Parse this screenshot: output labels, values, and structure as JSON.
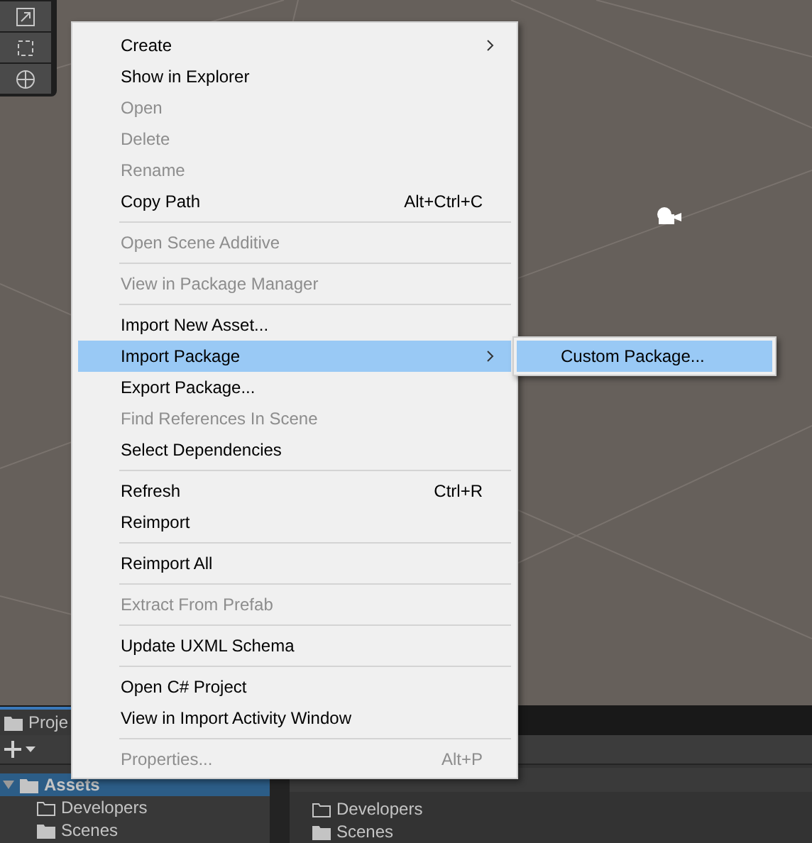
{
  "scene_toolbar": {
    "tools": [
      {
        "kind": "resize"
      },
      {
        "kind": "rect"
      },
      {
        "kind": "transform"
      }
    ]
  },
  "context_menu": {
    "items": [
      {
        "kind": "item",
        "label": "Create",
        "submenu": true,
        "disabled": false,
        "selected": false
      },
      {
        "kind": "item",
        "label": "Show in Explorer",
        "disabled": false,
        "selected": false
      },
      {
        "kind": "item",
        "label": "Open",
        "disabled": true,
        "selected": false
      },
      {
        "kind": "item",
        "label": "Delete",
        "disabled": true,
        "selected": false
      },
      {
        "kind": "item",
        "label": "Rename",
        "disabled": true,
        "selected": false
      },
      {
        "kind": "item",
        "label": "Copy Path",
        "shortcut": "Alt+Ctrl+C",
        "disabled": false,
        "selected": false
      },
      {
        "kind": "separator"
      },
      {
        "kind": "item",
        "label": "Open Scene Additive",
        "disabled": true,
        "selected": false
      },
      {
        "kind": "separator"
      },
      {
        "kind": "item",
        "label": "View in Package Manager",
        "disabled": true,
        "selected": false
      },
      {
        "kind": "separator"
      },
      {
        "kind": "item",
        "label": "Import New Asset...",
        "disabled": false,
        "selected": false
      },
      {
        "kind": "item",
        "label": "Import Package",
        "submenu": true,
        "disabled": false,
        "selected": true
      },
      {
        "kind": "item",
        "label": "Export Package...",
        "disabled": false,
        "selected": false
      },
      {
        "kind": "item",
        "label": "Find References In Scene",
        "disabled": true,
        "selected": false
      },
      {
        "kind": "item",
        "label": "Select Dependencies",
        "disabled": false,
        "selected": false
      },
      {
        "kind": "separator"
      },
      {
        "kind": "item",
        "label": "Refresh",
        "shortcut": "Ctrl+R",
        "disabled": false,
        "selected": false
      },
      {
        "kind": "item",
        "label": "Reimport",
        "disabled": false,
        "selected": false
      },
      {
        "kind": "separator"
      },
      {
        "kind": "item",
        "label": "Reimport All",
        "disabled": false,
        "selected": false
      },
      {
        "kind": "separator"
      },
      {
        "kind": "item",
        "label": "Extract From Prefab",
        "disabled": true,
        "selected": false
      },
      {
        "kind": "separator"
      },
      {
        "kind": "item",
        "label": "Update UXML Schema",
        "disabled": false,
        "selected": false
      },
      {
        "kind": "separator"
      },
      {
        "kind": "item",
        "label": "Open C# Project",
        "disabled": false,
        "selected": false
      },
      {
        "kind": "item",
        "label": "View in Import Activity Window",
        "disabled": false,
        "selected": false
      },
      {
        "kind": "separator"
      },
      {
        "kind": "item",
        "label": "Properties...",
        "shortcut": "Alt+P",
        "disabled": true,
        "selected": false
      }
    ]
  },
  "submenu": {
    "items": [
      {
        "label": "Custom Package...",
        "selected": true
      }
    ]
  },
  "project_panel": {
    "tab": "Proje",
    "tree": [
      {
        "label": "Assets",
        "selected": true,
        "expanded": true,
        "children": [
          {
            "label": "Developers",
            "kind": "empty"
          },
          {
            "label": "Scenes",
            "kind": "full"
          }
        ]
      }
    ],
    "files": [
      {
        "label": "Developers",
        "kind": "empty"
      },
      {
        "label": "Scenes",
        "kind": "full"
      }
    ]
  }
}
